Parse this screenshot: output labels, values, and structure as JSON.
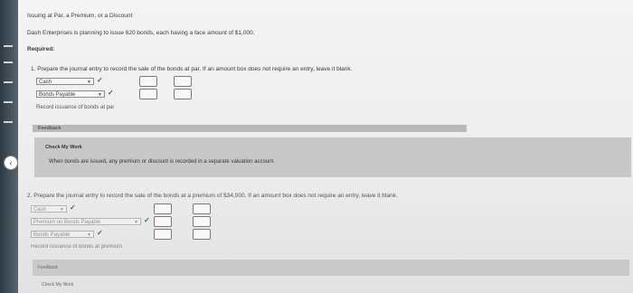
{
  "title": "Issuing at Par, a Premium, or a Discount",
  "intro": "Dash Enterprises is planning to issue 620 bonds, each having a face amount of $1,000.",
  "required_label": "Required:",
  "q1": {
    "prompt": "1. Prepare the journal entry to record the sale of the bonds at par. If an amount box does not require an entry, leave it blank.",
    "rows": [
      {
        "account": "Cash"
      },
      {
        "account": "Bonds Payable"
      }
    ],
    "description": "Record issuance of bonds at par",
    "feedback_label": "Feedback",
    "check_my_work": "Check My Work",
    "hint": "When bonds are issued, any premium or discount is recorded in a separate valuation account."
  },
  "q2": {
    "prompt": "2. Prepare the journal entry to record the sale of the bonds at a premium of $34,000. If an amount box does not require an entry, leave it blank.",
    "rows": [
      {
        "account": "Cash"
      },
      {
        "account": "Premium on Bonds Payable"
      },
      {
        "account": "Bonds Payable"
      }
    ],
    "description": "Record issuance of bonds at premium",
    "feedback_label": "Feedback",
    "check_my_work": "Check My Work"
  },
  "icons": {
    "check": "✓",
    "dropdown": "▼",
    "toggle": "‹"
  },
  "colors": {
    "check": "#2a7a2a",
    "panel": "#c8c8c8"
  }
}
